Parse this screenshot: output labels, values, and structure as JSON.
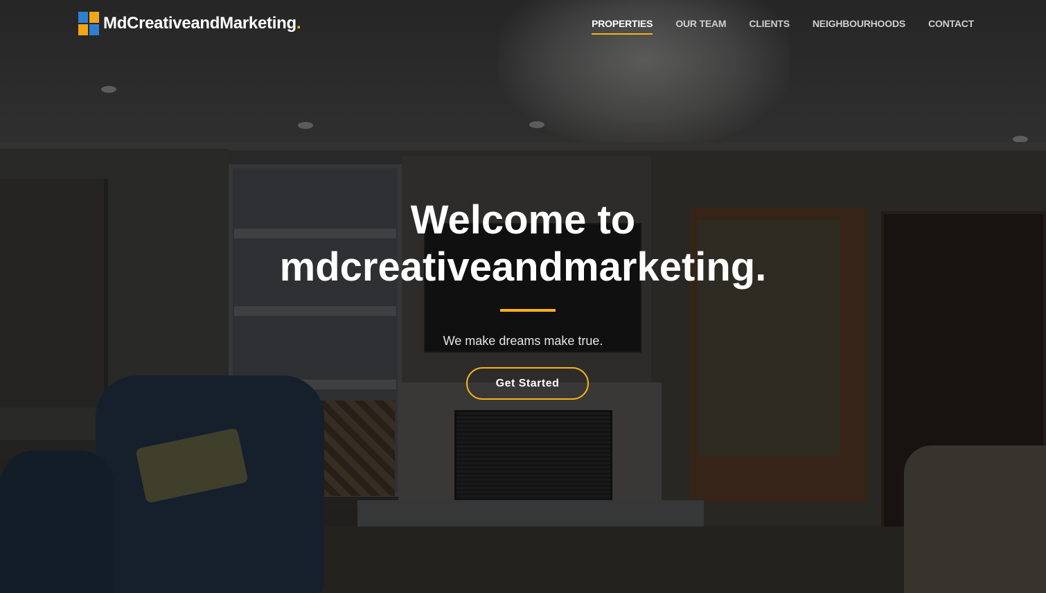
{
  "brand": {
    "name": "MdCreativeandMarketing",
    "dot": ".",
    "mark_letters": [
      "M",
      "D"
    ],
    "colors": {
      "accent": "#f8b418",
      "blue": "#2f7fd1",
      "text": "#ffffff"
    }
  },
  "nav": {
    "items": [
      {
        "label": "PROPERTIES",
        "active": true
      },
      {
        "label": "OUR TEAM",
        "active": false
      },
      {
        "label": "CLIENTS",
        "active": false
      },
      {
        "label": "NEIGHBOURHOODS",
        "active": false
      },
      {
        "label": "CONTACT",
        "active": false
      }
    ]
  },
  "hero": {
    "title_line1": "Welcome to",
    "title_line2": "mdcreativeandmarketing.",
    "subtitle": "We make dreams make true.",
    "cta_label": "Get Started"
  }
}
